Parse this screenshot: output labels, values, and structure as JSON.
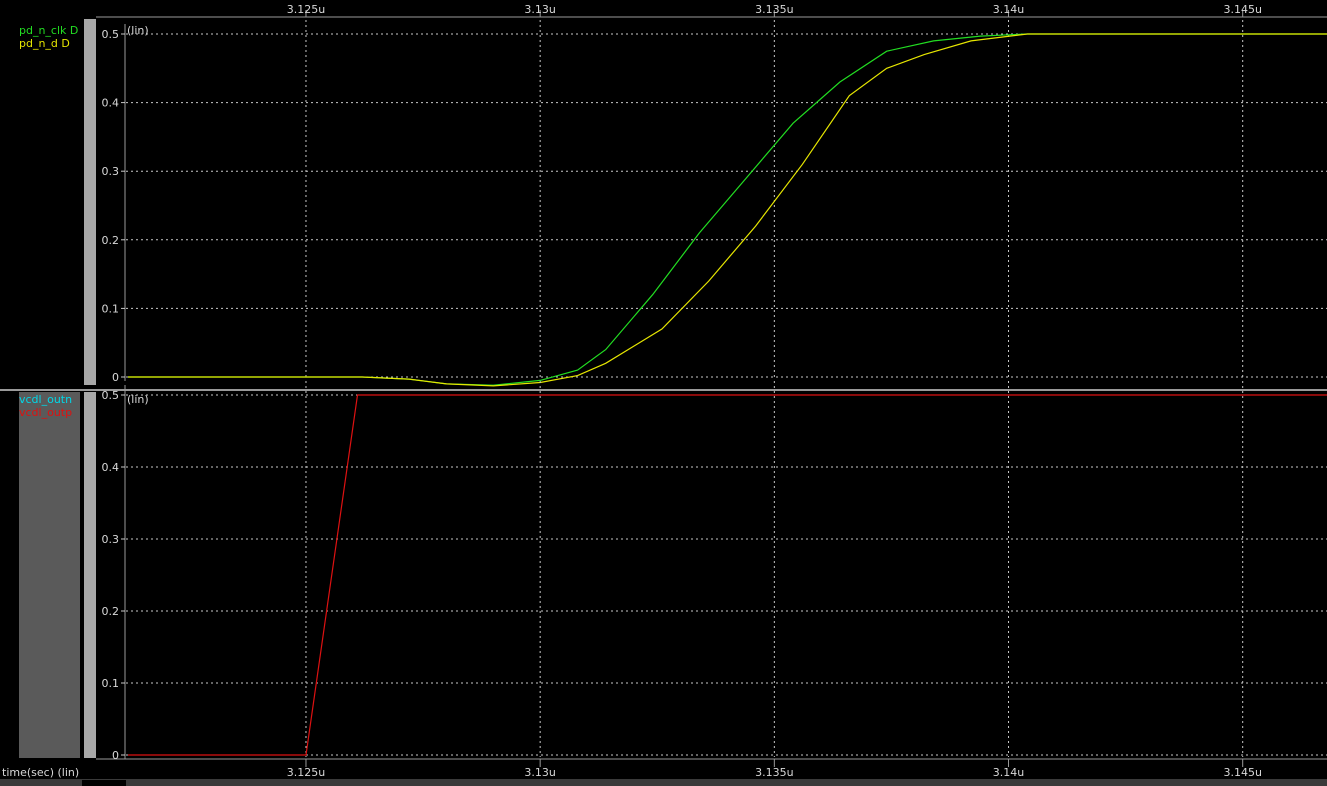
{
  "time_axis": {
    "ticks": [
      "3.125u",
      "3.13u",
      "3.135u",
      "3.14u",
      "3.145u"
    ],
    "tick_values": [
      3.125,
      3.13,
      3.135,
      3.14,
      3.145
    ],
    "range": [
      3.1212,
      3.1468
    ],
    "label": "time(sec) (lin)"
  },
  "panels": [
    {
      "id": "top",
      "scale_label": "(lin)",
      "signals": [
        {
          "name": "pd_n_clk",
          "suffix": "D",
          "color": "#22dd22"
        },
        {
          "name": "pd_n_d",
          "suffix": "D",
          "color": "#e6e600"
        }
      ]
    },
    {
      "id": "bottom",
      "scale_label": "(lin)",
      "signals": [
        {
          "name": "vcdl_outn",
          "color": "#00d8e8"
        },
        {
          "name": "vcdl_outp",
          "color": "#dd1111"
        }
      ]
    }
  ],
  "colors": {
    "background": "#000000",
    "grid": "#c8c8c8",
    "label_panel": "#5a5a5a",
    "scrollbar": "#a8a8a8"
  },
  "chart_data": [
    {
      "type": "line",
      "title": "",
      "xlabel": "time(sec) (lin)",
      "ylabel": "(lin)",
      "xlim": [
        3.1212,
        3.1468
      ],
      "ylim": [
        -0.005,
        0.5
      ],
      "yticks": [
        0,
        0.1,
        0.2,
        0.3,
        0.4,
        0.5
      ],
      "ytick_labels": [
        "0",
        "0.1",
        "0.2",
        "0.3",
        "0.4",
        "0.5"
      ],
      "grid": true,
      "series": [
        {
          "name": "pd_n_clk",
          "color": "#22dd22",
          "x": [
            3.1212,
            3.1262,
            3.1272,
            3.128,
            3.129,
            3.13,
            3.1308,
            3.1314,
            3.1324,
            3.1334,
            3.1344,
            3.1354,
            3.1364,
            3.1374,
            3.1384,
            3.1394,
            3.1404,
            3.1468
          ],
          "y": [
            0,
            0,
            -0.003,
            -0.01,
            -0.012,
            -0.005,
            0.01,
            0.04,
            0.12,
            0.21,
            0.29,
            0.37,
            0.43,
            0.475,
            0.49,
            0.497,
            0.5,
            0.5
          ]
        },
        {
          "name": "pd_n_d",
          "color": "#e6e600",
          "x": [
            3.1212,
            3.1262,
            3.1272,
            3.128,
            3.129,
            3.13,
            3.1308,
            3.1314,
            3.1326,
            3.1336,
            3.1346,
            3.1356,
            3.1366,
            3.1374,
            3.1382,
            3.1392,
            3.1404,
            3.1468
          ],
          "y": [
            0,
            0,
            -0.003,
            -0.01,
            -0.013,
            -0.008,
            0.002,
            0.02,
            0.07,
            0.14,
            0.22,
            0.31,
            0.41,
            0.45,
            0.47,
            0.49,
            0.5,
            0.5
          ]
        }
      ]
    },
    {
      "type": "line",
      "title": "",
      "xlabel": "time(sec) (lin)",
      "ylabel": "(lin)",
      "xlim": [
        3.1212,
        3.1468
      ],
      "ylim": [
        -0.005,
        0.5
      ],
      "yticks": [
        0,
        0.1,
        0.2,
        0.3,
        0.4,
        0.5
      ],
      "ytick_labels": [
        "0",
        "0.1",
        "0.2",
        "0.3",
        "0.4",
        "0.5"
      ],
      "grid": true,
      "series": [
        {
          "name": "vcdl_outp",
          "color": "#dd1111",
          "x": [
            3.1212,
            3.125,
            3.1261,
            3.1468
          ],
          "y": [
            0,
            0,
            0.5,
            0.5
          ]
        }
      ]
    }
  ]
}
